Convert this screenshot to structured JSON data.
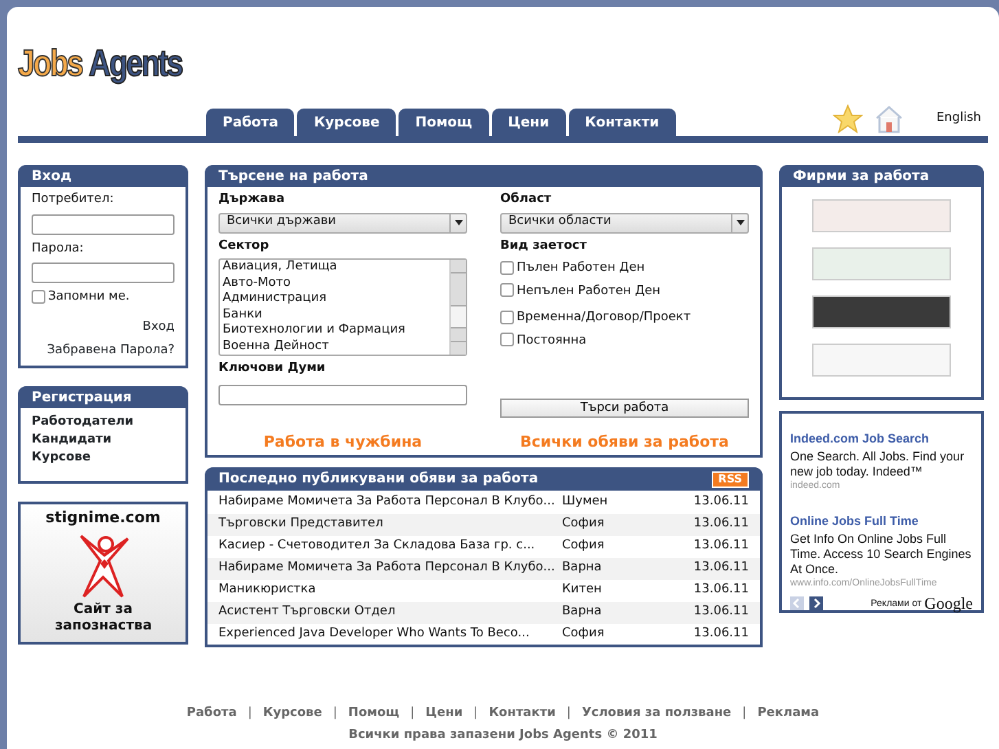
{
  "logo": {
    "part_1": "Jobs",
    "part_2": "Agents"
  },
  "nav_tabs": [
    {
      "label": "Работа"
    },
    {
      "label": "Курсове"
    },
    {
      "label": "Помощ"
    },
    {
      "label": "Цени"
    },
    {
      "label": "Контакти"
    }
  ],
  "language_link": "English",
  "login": {
    "title": "Вход",
    "username_label": "Потребител:",
    "password_label": "Парола:",
    "remember_label": "Запомни ме.",
    "remember_checked": false,
    "login_link": "Вход",
    "forgot_link": "Забравена Парола?"
  },
  "registration": {
    "title": "Регистрация",
    "links": [
      "Работодатели",
      "Кандидати",
      "Курсове"
    ]
  },
  "dating_ad": {
    "site": "stignime.com",
    "caption": "Сайт за запознаства"
  },
  "job_search": {
    "title": "Търсене на работа",
    "country_label": "Държава",
    "country_value": "Всички държави",
    "region_label": "Област",
    "region_value": "Всички области",
    "sector_label": "Сектор",
    "sectors": [
      "Авиация, Летища",
      "Авто-Мото",
      "Администрация",
      "Банки",
      "Биотехнологии и Фармация",
      "Военна Дейност"
    ],
    "employment_label": "Вид заетост",
    "employment_types": [
      {
        "label": "Пълен Работен Ден",
        "checked": false
      },
      {
        "label": "Непълен Работен Ден",
        "checked": false
      },
      {
        "label": "Временна/Договор/Проект",
        "checked": false
      },
      {
        "label": "Постоянна",
        "checked": false
      }
    ],
    "keywords_label": "Ключови Думи",
    "search_button": "Търси работа",
    "abroad_link": "Работа в чужбина",
    "all_jobs_link": "Всички обяви за работа"
  },
  "latest_jobs": {
    "title": "Последно публикувани обяви за работа",
    "rss_label": "RSS",
    "rows": [
      {
        "title": "Набираме Момичета За Работа Персонал В Клубо...",
        "city": "Шумен",
        "date": "13.06.11"
      },
      {
        "title": "Търговски Представител",
        "city": "София",
        "date": "13.06.11"
      },
      {
        "title": "Касиер - Счетоводител За Складова База гр. с...",
        "city": "София",
        "date": "13.06.11"
      },
      {
        "title": "Набираме Момичета За Работа Персонал В Клубо...",
        "city": "Варна",
        "date": "13.06.11"
      },
      {
        "title": "Маникюристка",
        "city": "Китен",
        "date": "13.06.11"
      },
      {
        "title": "Асистент Търговски Отдел",
        "city": "Варна",
        "date": "13.06.11"
      },
      {
        "title": "Experienced Java Developer Who Wants To Beco...",
        "city": "София",
        "date": "13.06.11"
      }
    ]
  },
  "companies": {
    "title": "Фирми за работа",
    "logos": [
      {
        "color": "#f4ecea"
      },
      {
        "color": "#e9f1ea"
      },
      {
        "color": "#3a3a3a"
      },
      {
        "color": "#f7f7f7"
      }
    ]
  },
  "ads": {
    "items": [
      {
        "title": "Indeed.com Job Search",
        "text": "One Search. All Jobs. Find your new job today. Indeed™",
        "url": "indeed.com"
      },
      {
        "title": "Online Jobs Full Time",
        "text": "Get Info On Online Jobs Full Time. Access 10 Search Engines At Once.",
        "url": "www.info.com/OnlineJobsFullTime"
      }
    ],
    "attribution": "Реклами от",
    "brand": "Google"
  },
  "footer": {
    "links": [
      "Работа",
      "Курсове",
      "Помощ",
      "Цени",
      "Контакти",
      "Условия за ползване",
      "Реклама"
    ],
    "separator": "|",
    "copyright": "Всички права запазени Jobs Agents © 2011"
  }
}
